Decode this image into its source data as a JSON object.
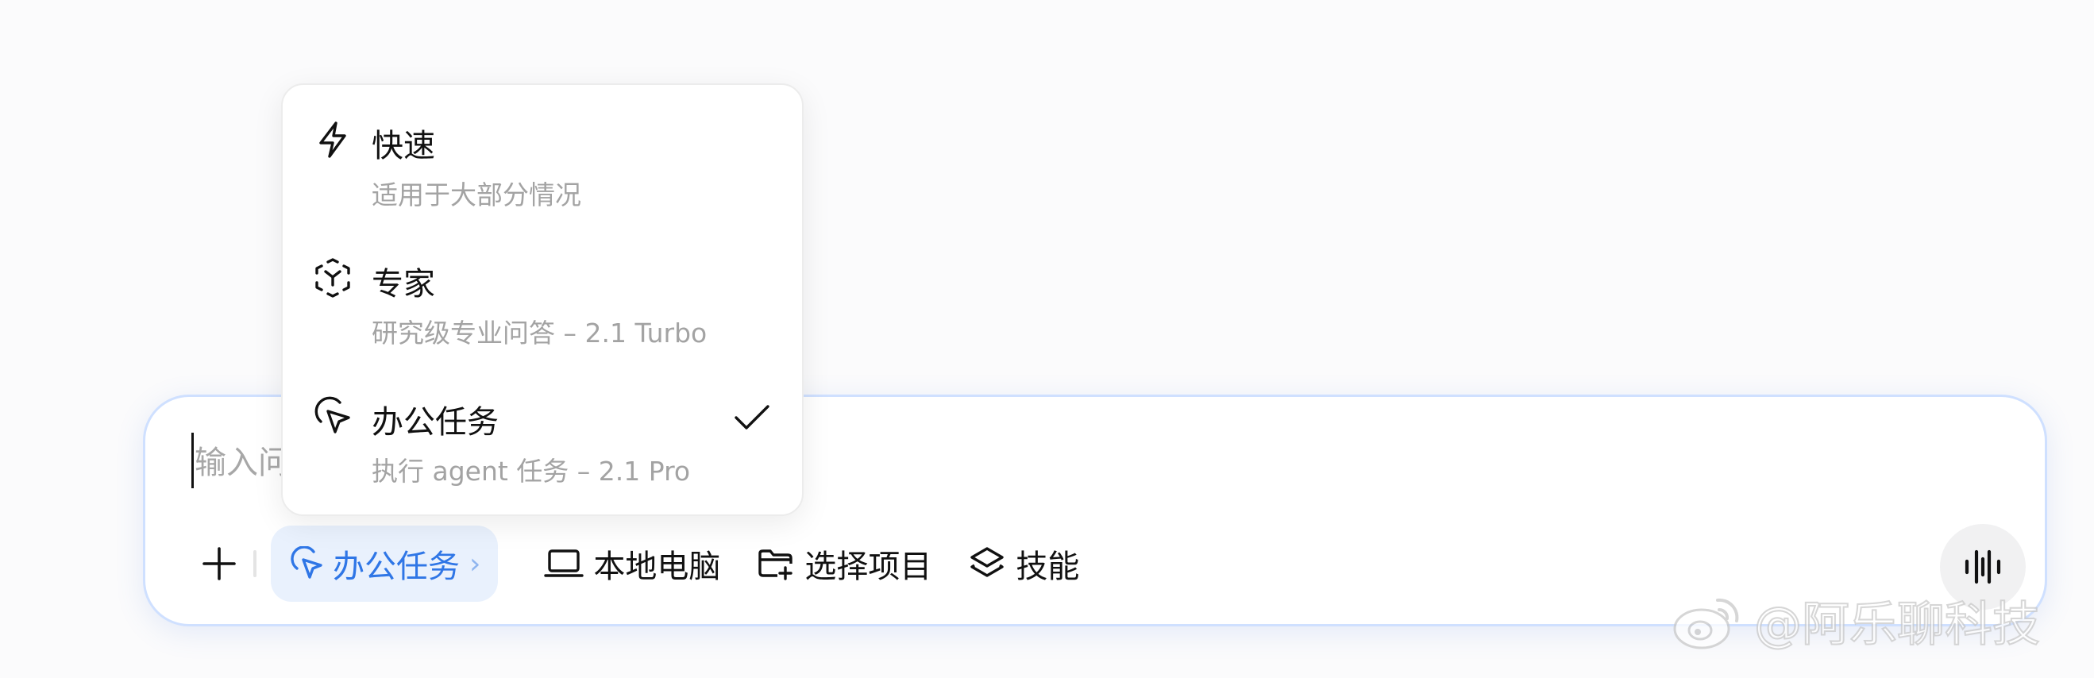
{
  "input": {
    "placeholder": "输入问题"
  },
  "toolbar": {
    "mode_chip_label": "办公任务",
    "mode_chip_chevron": "›",
    "local_computer_label": "本地电脑",
    "select_project_label": "选择项目",
    "skills_label": "技能"
  },
  "mode_menu": {
    "items": [
      {
        "title": "快速",
        "description": "适用于大部分情况",
        "icon": "lightning-icon",
        "selected": false
      },
      {
        "title": "专家",
        "description": "研究级专业问答 – 2.1 Turbo",
        "icon": "expert-cube-icon",
        "selected": false
      },
      {
        "title": "办公任务",
        "description": "执行 agent 任务 – 2.1 Pro",
        "icon": "cursor-pointer-icon",
        "selected": true
      }
    ]
  },
  "watermark": {
    "text": "@阿乐聊科技",
    "icon": "weibo-icon"
  },
  "colors": {
    "accent": "#2f76e6",
    "chip_background": "#e9f1fd",
    "card_border": "#cfe0ff",
    "muted_text": "#a3a3a3"
  }
}
